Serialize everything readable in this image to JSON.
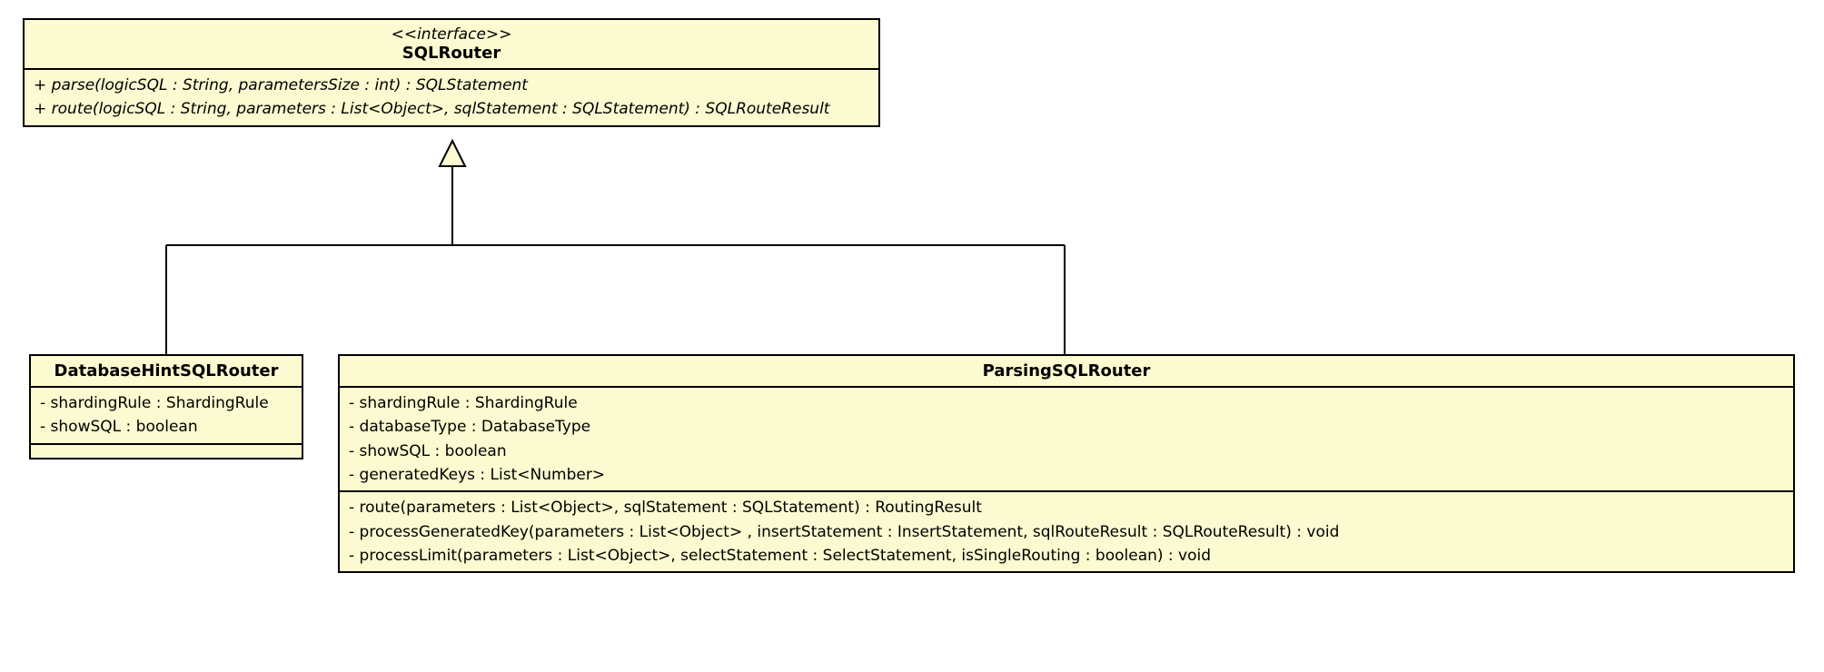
{
  "interface": {
    "stereotype": "<<interface>>",
    "name": "SQLRouter",
    "operations": [
      "+ parse(logicSQL : String, parametersSize : int) : SQLStatement",
      "+ route(logicSQL : String, parameters : List<Object>, sqlStatement : SQLStatement) : SQLRouteResult"
    ]
  },
  "classA": {
    "name": "DatabaseHintSQLRouter",
    "attributes": [
      "- shardingRule : ShardingRule",
      "- showSQL : boolean"
    ],
    "operations": []
  },
  "classB": {
    "name": "ParsingSQLRouter",
    "attributes": [
      "- shardingRule : ShardingRule",
      "- databaseType : DatabaseType",
      "- showSQL : boolean",
      "- generatedKeys : List<Number>"
    ],
    "operations": [
      "- route(parameters : List<Object>, sqlStatement : SQLStatement) : RoutingResult",
      "- processGeneratedKey(parameters : List<Object> , insertStatement : InsertStatement, sqlRouteResult : SQLRouteResult) : void",
      "- processLimit(parameters : List<Object>, selectStatement : SelectStatement, isSingleRouting : boolean) : void"
    ]
  },
  "chart_data": {
    "type": "uml_class_diagram",
    "classes": [
      {
        "id": "SQLRouter",
        "kind": "interface",
        "members": {
          "operations": [
            "parse(logicSQL:String, parametersSize:int):SQLStatement",
            "route(logicSQL:String, parameters:List<Object>, sqlStatement:SQLStatement):SQLRouteResult"
          ]
        }
      },
      {
        "id": "DatabaseHintSQLRouter",
        "kind": "class",
        "members": {
          "attributes": [
            "shardingRule:ShardingRule",
            "showSQL:boolean"
          ]
        }
      },
      {
        "id": "ParsingSQLRouter",
        "kind": "class",
        "members": {
          "attributes": [
            "shardingRule:ShardingRule",
            "databaseType:DatabaseType",
            "showSQL:boolean",
            "generatedKeys:List<Number>"
          ],
          "operations": [
            "route(parameters:List<Object>, sqlStatement:SQLStatement):RoutingResult",
            "processGeneratedKey(parameters:List<Object>, insertStatement:InsertStatement, sqlRouteResult:SQLRouteResult):void",
            "processLimit(parameters:List<Object>, selectStatement:SelectStatement, isSingleRouting:boolean):void"
          ]
        }
      }
    ],
    "relationships": [
      {
        "from": "DatabaseHintSQLRouter",
        "to": "SQLRouter",
        "type": "realization"
      },
      {
        "from": "ParsingSQLRouter",
        "to": "SQLRouter",
        "type": "realization"
      }
    ]
  }
}
